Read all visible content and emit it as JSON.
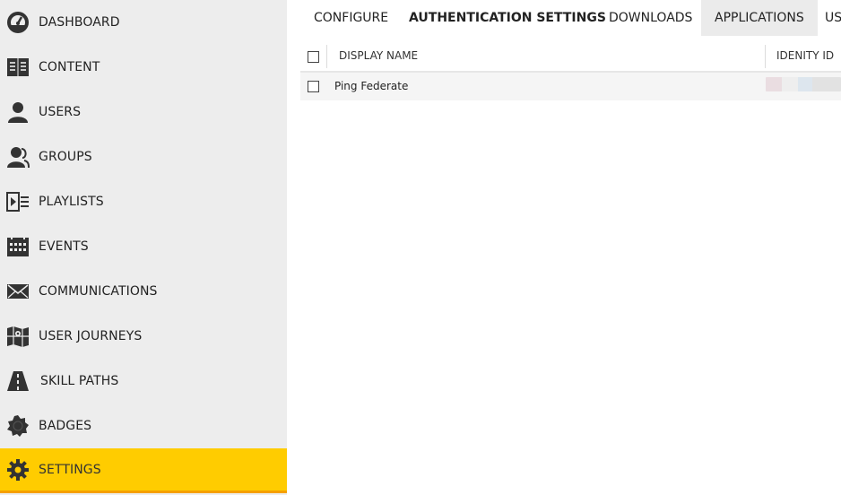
{
  "sidebar": {
    "items": [
      {
        "label": "DASHBOARD",
        "icon": "dashboard-gauge-icon"
      },
      {
        "label": "CONTENT",
        "icon": "open-book-icon"
      },
      {
        "label": "USERS",
        "icon": "user-icon"
      },
      {
        "label": "GROUPS",
        "icon": "users-group-icon"
      },
      {
        "label": "PLAYLISTS",
        "icon": "playlist-icon"
      },
      {
        "label": "EVENTS",
        "icon": "calendar-icon"
      },
      {
        "label": "COMMUNICATIONS",
        "icon": "envelope-icon"
      },
      {
        "label": "USER JOURNEYS",
        "icon": "map-icon"
      },
      {
        "label": "SKILL PATHS",
        "icon": "road-icon"
      },
      {
        "label": "BADGES",
        "icon": "badge-icon"
      },
      {
        "label": "SETTINGS",
        "icon": "gear-icon",
        "active": true
      }
    ]
  },
  "tabs": [
    "CONFIGURE",
    "AUTHENTICATION SETTINGS",
    "DOWNLOADS",
    "APPLICATIONS",
    "US"
  ],
  "table": {
    "columns": [
      "DISPLAY NAME",
      "IDENITY ID"
    ],
    "rows": [
      {
        "display_name": "Ping Federate",
        "identity_id_redacted": true
      }
    ]
  },
  "colors": {
    "sidebar_bg": "#ededed",
    "active_bg": "#ffcc00",
    "active_border": "#f5a000"
  }
}
